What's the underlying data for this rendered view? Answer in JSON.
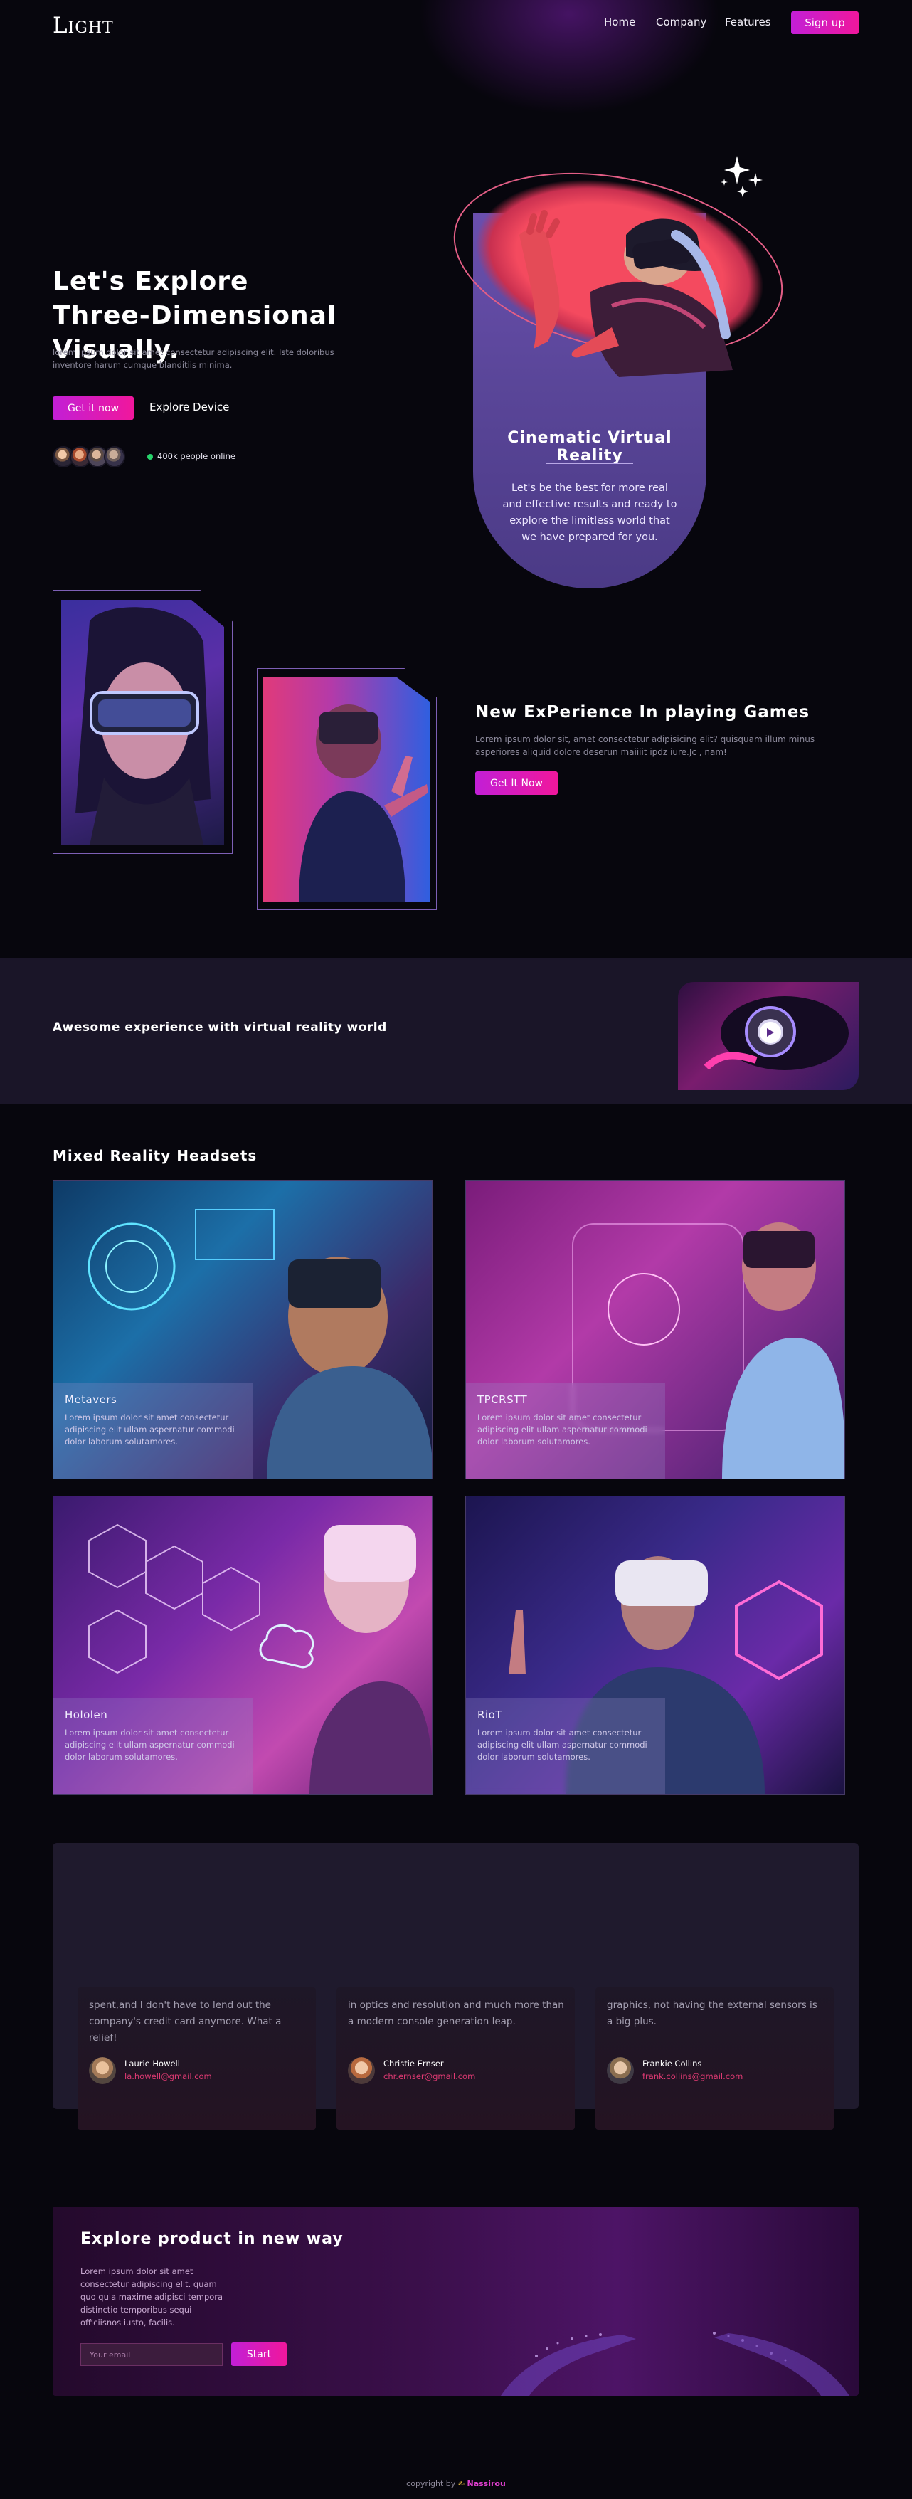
{
  "nav": {
    "logo": "Light",
    "links": [
      "Home",
      "Company",
      "Features"
    ],
    "signup": "Sign up"
  },
  "hero": {
    "title_line1": "Let's Explore",
    "title_line2": "Three-Dimensional Visually.",
    "description": "lorem ipsum dolor sit amet consectetur adipiscing elit. Iste doloribus inventore harum cumque blanditiis minima.",
    "primary_button": "Get it now",
    "secondary_button": "Explore Device",
    "online_text": "400k people online",
    "card_title": "Cinematic Virtual Reality",
    "card_text": "Let's be the best for more real and effective results and ready to explore the limitless world that we have prepared for you."
  },
  "games": {
    "title": "New ExPerience In playing Games",
    "text": "Lorem ipsum dolor sit, amet consectetur adipisicing elit? quisquam illum minus asperiores aliquid dolore deserun maiiiit ipdz iure.Jc , nam!",
    "button": "Get It Now"
  },
  "band": {
    "title": "Awesome experience with virtual reality world"
  },
  "gallery": {
    "title": "Mixed Reality Headsets",
    "items": [
      {
        "title": "Metavers",
        "text": "Lorem ipsum dolor sit amet consectetur adipiscing elit ullam aspernatur commodi dolor laborum solutamores."
      },
      {
        "title": "TPCRSTT",
        "text": "Lorem ipsum dolor sit amet consectetur adipiscing elit ullam aspernatur commodi dolor laborum solutamores."
      },
      {
        "title": "Hololen",
        "text": "Lorem ipsum dolor sit amet consectetur adipiscing elit ullam aspernatur commodi dolor laborum solutamores."
      },
      {
        "title": "RioT",
        "text": "Lorem ipsum dolor sit amet consectetur adipiscing elit ullam aspernatur commodi dolor laborum solutamores."
      }
    ]
  },
  "testimonials": [
    {
      "text": "spent,and I don't have to lend out the company's credit card anymore. What a relief!",
      "name": "Laurie Howell",
      "email": "la.howell@gmail.com"
    },
    {
      "text": "in optics and resolution and much more than a modern console generation leap.",
      "name": "Christie Ernser",
      "email": "chr.ernser@gmail.com"
    },
    {
      "text": "graphics, not having the external sensors is a big plus.",
      "name": "Frankie Collins",
      "email": "frank.collins@gmail.com"
    }
  ],
  "explore": {
    "title": "Explore product in new way",
    "text": "Lorem ipsum dolor sit amet consectetur adipiscing elit. quam quo quia maxime adipisci tempora distinctio temporibus sequi officiisnos iusto, facilis.",
    "email_placeholder": "Your email",
    "button": "Start"
  },
  "footer": {
    "prefix": "copyright by",
    "brand": "Nassirou"
  }
}
